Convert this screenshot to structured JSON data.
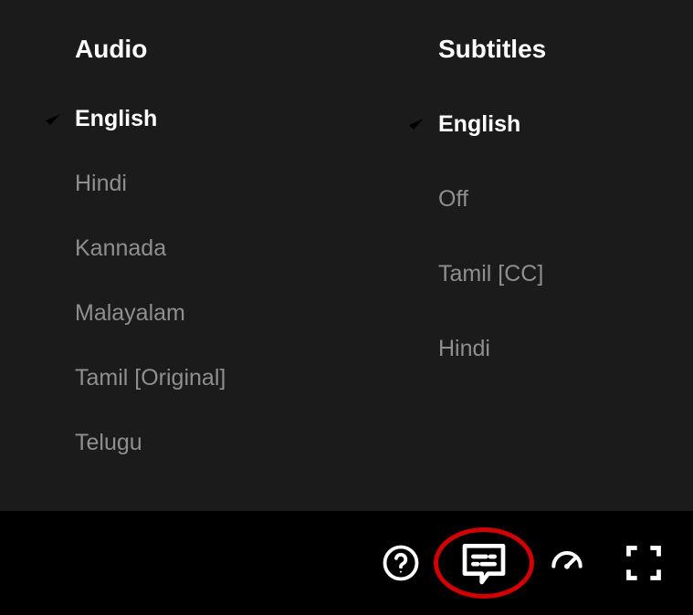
{
  "audio": {
    "title": "Audio",
    "options": [
      {
        "label": "English",
        "selected": true
      },
      {
        "label": "Hindi",
        "selected": false
      },
      {
        "label": "Kannada",
        "selected": false
      },
      {
        "label": "Malayalam",
        "selected": false
      },
      {
        "label": "Tamil [Original]",
        "selected": false
      },
      {
        "label": "Telugu",
        "selected": false
      }
    ]
  },
  "subtitles": {
    "title": "Subtitles",
    "options": [
      {
        "label": "English",
        "selected": true
      },
      {
        "label": "Off",
        "selected": false
      },
      {
        "label": "Tamil [CC]",
        "selected": false
      },
      {
        "label": "Hindi",
        "selected": false
      }
    ]
  },
  "controls": {
    "help_icon": "help-icon",
    "subtitles_icon": "subtitles-icon",
    "speed_icon": "speed-icon",
    "fullscreen_icon": "fullscreen-icon"
  }
}
